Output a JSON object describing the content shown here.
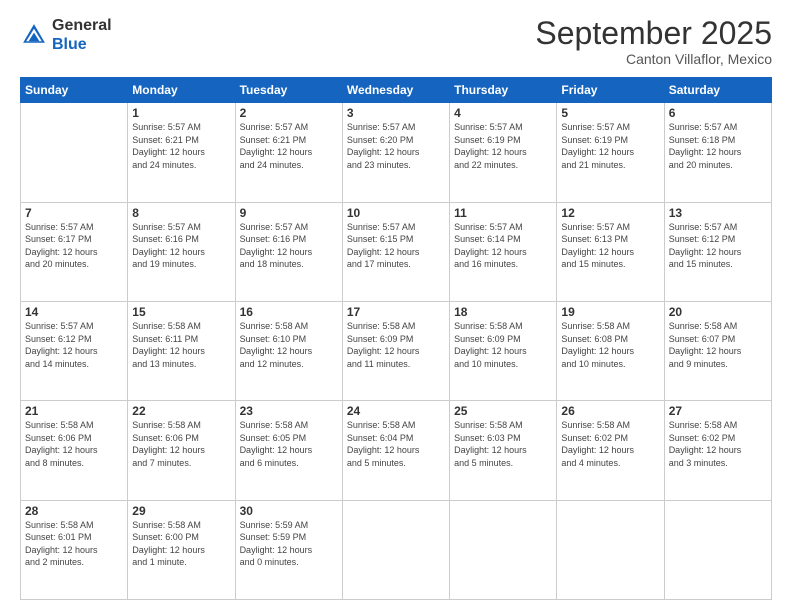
{
  "header": {
    "logo": {
      "line1": "General",
      "line2": "Blue"
    },
    "title": "September 2025",
    "location": "Canton Villaflor, Mexico"
  },
  "weekdays": [
    "Sunday",
    "Monday",
    "Tuesday",
    "Wednesday",
    "Thursday",
    "Friday",
    "Saturday"
  ],
  "weeks": [
    [
      {
        "day": "",
        "info": ""
      },
      {
        "day": "1",
        "info": "Sunrise: 5:57 AM\nSunset: 6:21 PM\nDaylight: 12 hours\nand 24 minutes."
      },
      {
        "day": "2",
        "info": "Sunrise: 5:57 AM\nSunset: 6:21 PM\nDaylight: 12 hours\nand 24 minutes."
      },
      {
        "day": "3",
        "info": "Sunrise: 5:57 AM\nSunset: 6:20 PM\nDaylight: 12 hours\nand 23 minutes."
      },
      {
        "day": "4",
        "info": "Sunrise: 5:57 AM\nSunset: 6:19 PM\nDaylight: 12 hours\nand 22 minutes."
      },
      {
        "day": "5",
        "info": "Sunrise: 5:57 AM\nSunset: 6:19 PM\nDaylight: 12 hours\nand 21 minutes."
      },
      {
        "day": "6",
        "info": "Sunrise: 5:57 AM\nSunset: 6:18 PM\nDaylight: 12 hours\nand 20 minutes."
      }
    ],
    [
      {
        "day": "7",
        "info": "Sunrise: 5:57 AM\nSunset: 6:17 PM\nDaylight: 12 hours\nand 20 minutes."
      },
      {
        "day": "8",
        "info": "Sunrise: 5:57 AM\nSunset: 6:16 PM\nDaylight: 12 hours\nand 19 minutes."
      },
      {
        "day": "9",
        "info": "Sunrise: 5:57 AM\nSunset: 6:16 PM\nDaylight: 12 hours\nand 18 minutes."
      },
      {
        "day": "10",
        "info": "Sunrise: 5:57 AM\nSunset: 6:15 PM\nDaylight: 12 hours\nand 17 minutes."
      },
      {
        "day": "11",
        "info": "Sunrise: 5:57 AM\nSunset: 6:14 PM\nDaylight: 12 hours\nand 16 minutes."
      },
      {
        "day": "12",
        "info": "Sunrise: 5:57 AM\nSunset: 6:13 PM\nDaylight: 12 hours\nand 15 minutes."
      },
      {
        "day": "13",
        "info": "Sunrise: 5:57 AM\nSunset: 6:12 PM\nDaylight: 12 hours\nand 15 minutes."
      }
    ],
    [
      {
        "day": "14",
        "info": "Sunrise: 5:57 AM\nSunset: 6:12 PM\nDaylight: 12 hours\nand 14 minutes."
      },
      {
        "day": "15",
        "info": "Sunrise: 5:58 AM\nSunset: 6:11 PM\nDaylight: 12 hours\nand 13 minutes."
      },
      {
        "day": "16",
        "info": "Sunrise: 5:58 AM\nSunset: 6:10 PM\nDaylight: 12 hours\nand 12 minutes."
      },
      {
        "day": "17",
        "info": "Sunrise: 5:58 AM\nSunset: 6:09 PM\nDaylight: 12 hours\nand 11 minutes."
      },
      {
        "day": "18",
        "info": "Sunrise: 5:58 AM\nSunset: 6:09 PM\nDaylight: 12 hours\nand 10 minutes."
      },
      {
        "day": "19",
        "info": "Sunrise: 5:58 AM\nSunset: 6:08 PM\nDaylight: 12 hours\nand 10 minutes."
      },
      {
        "day": "20",
        "info": "Sunrise: 5:58 AM\nSunset: 6:07 PM\nDaylight: 12 hours\nand 9 minutes."
      }
    ],
    [
      {
        "day": "21",
        "info": "Sunrise: 5:58 AM\nSunset: 6:06 PM\nDaylight: 12 hours\nand 8 minutes."
      },
      {
        "day": "22",
        "info": "Sunrise: 5:58 AM\nSunset: 6:06 PM\nDaylight: 12 hours\nand 7 minutes."
      },
      {
        "day": "23",
        "info": "Sunrise: 5:58 AM\nSunset: 6:05 PM\nDaylight: 12 hours\nand 6 minutes."
      },
      {
        "day": "24",
        "info": "Sunrise: 5:58 AM\nSunset: 6:04 PM\nDaylight: 12 hours\nand 5 minutes."
      },
      {
        "day": "25",
        "info": "Sunrise: 5:58 AM\nSunset: 6:03 PM\nDaylight: 12 hours\nand 5 minutes."
      },
      {
        "day": "26",
        "info": "Sunrise: 5:58 AM\nSunset: 6:02 PM\nDaylight: 12 hours\nand 4 minutes."
      },
      {
        "day": "27",
        "info": "Sunrise: 5:58 AM\nSunset: 6:02 PM\nDaylight: 12 hours\nand 3 minutes."
      }
    ],
    [
      {
        "day": "28",
        "info": "Sunrise: 5:58 AM\nSunset: 6:01 PM\nDaylight: 12 hours\nand 2 minutes."
      },
      {
        "day": "29",
        "info": "Sunrise: 5:58 AM\nSunset: 6:00 PM\nDaylight: 12 hours\nand 1 minute."
      },
      {
        "day": "30",
        "info": "Sunrise: 5:59 AM\nSunset: 5:59 PM\nDaylight: 12 hours\nand 0 minutes."
      },
      {
        "day": "",
        "info": ""
      },
      {
        "day": "",
        "info": ""
      },
      {
        "day": "",
        "info": ""
      },
      {
        "day": "",
        "info": ""
      }
    ]
  ]
}
